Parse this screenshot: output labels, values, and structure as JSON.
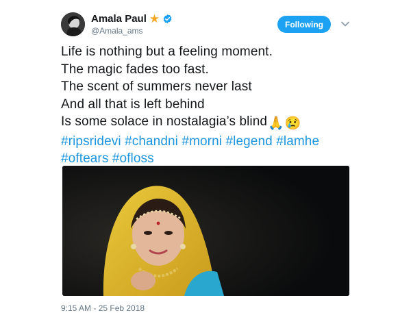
{
  "author": {
    "name": "Amala Paul",
    "handle": "@Amala_ams",
    "badge_icon": "star-icon",
    "verified_icon": "verified-badge-icon"
  },
  "follow_button": {
    "label": "Following"
  },
  "tweet": {
    "lines": [
      "Life is nothing but a feeling moment.",
      "The magic fades too fast.",
      "The scent of summers never last",
      "And all that is left behind",
      "Is some solace in nostalagia’s blind"
    ],
    "emojis": [
      "🙏",
      "😢"
    ],
    "hashtag_lines": [
      [
        "#ripsridevi",
        "#chandni",
        "#morni",
        "#legend",
        "#lamhe"
      ],
      [
        "#oftears",
        "#ofloss"
      ]
    ]
  },
  "timestamp": "9:15 AM - 25 Feb 2018",
  "colors": {
    "follow_button": "#1da1f2",
    "hashtag": "#1b95e0",
    "star": "#f5a623",
    "verified": "#1da1f2"
  }
}
